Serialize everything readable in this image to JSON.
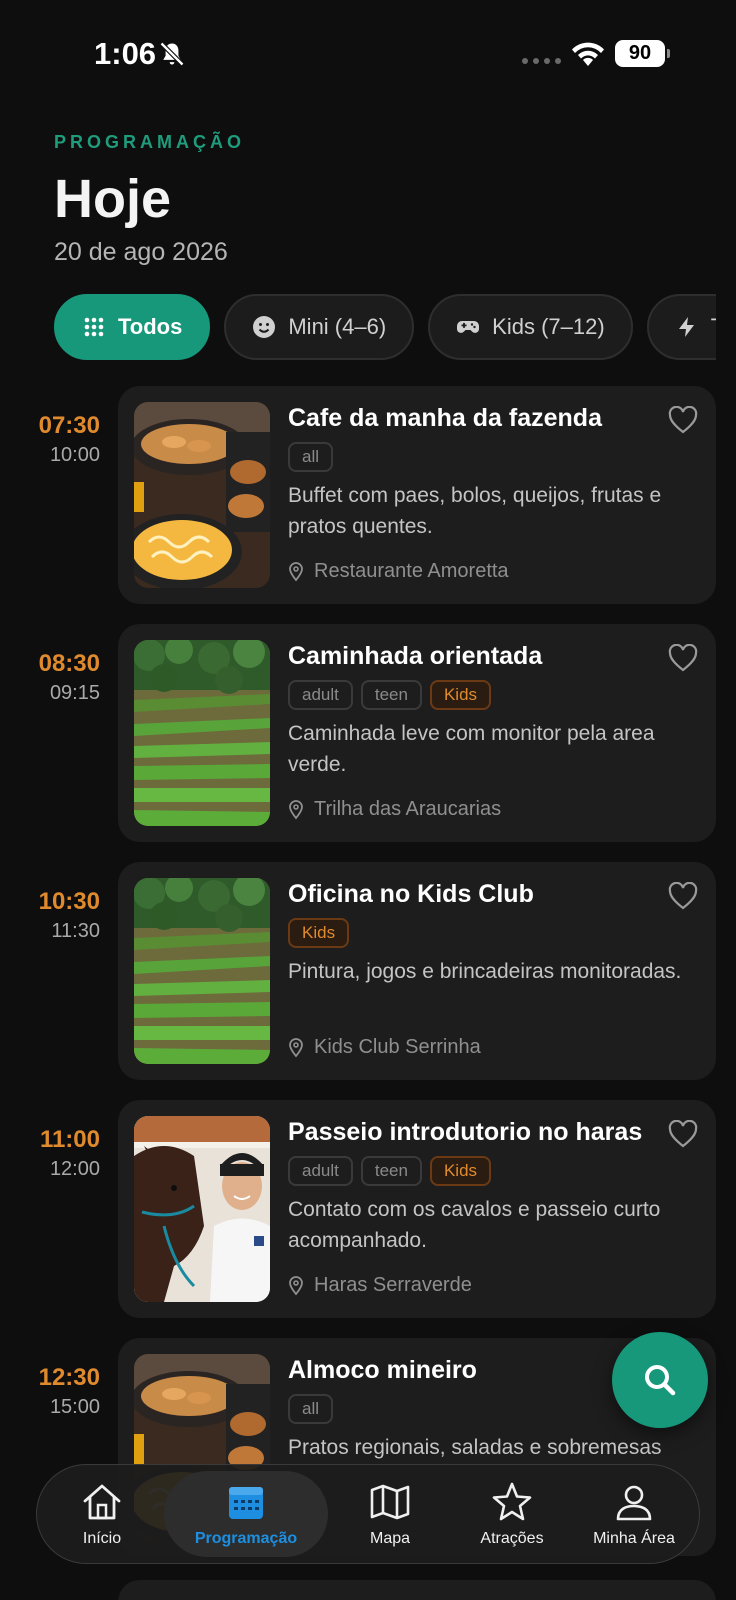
{
  "status_bar": {
    "time": "1:06",
    "battery": "90"
  },
  "header": {
    "kicker": "PROGRAMAÇÃO",
    "title": "Hoje",
    "date": "20 de ago 2026"
  },
  "filters": [
    {
      "label": "Todos",
      "icon": "grid-icon",
      "active": true
    },
    {
      "label": "Mini (4–6)",
      "icon": "smile-icon",
      "active": false
    },
    {
      "label": "Kids (7–12)",
      "icon": "gamepad-icon",
      "active": false
    },
    {
      "label": "T",
      "icon": "bolt-icon",
      "active": false
    }
  ],
  "events": [
    {
      "start": "07:30",
      "end": "10:00",
      "title": "Cafe da manha da fazenda",
      "tags": [
        "all"
      ],
      "description": "Buffet com paes, bolos, queijos, frutas e pratos quentes.",
      "location": "Restaurante Amoretta",
      "image": "food"
    },
    {
      "start": "08:30",
      "end": "09:15",
      "title": "Caminhada orientada",
      "tags": [
        "adult",
        "teen",
        "Kids"
      ],
      "description": "Caminhada leve com monitor pela area verde.",
      "location": "Trilha das Araucarias",
      "image": "garden"
    },
    {
      "start": "10:30",
      "end": "11:30",
      "title": "Oficina no Kids Club",
      "tags": [
        "Kids"
      ],
      "description": "Pintura, jogos e brincadeiras monitoradas.",
      "location": "Kids Club Serrinha",
      "image": "garden"
    },
    {
      "start": "11:00",
      "end": "12:00",
      "title": "Passeio introdutorio no haras",
      "tags": [
        "adult",
        "teen",
        "Kids"
      ],
      "description": "Contato com os cavalos e passeio curto acompanhado.",
      "location": "Haras Serraverde",
      "image": "horse"
    },
    {
      "start": "12:30",
      "end": "15:00",
      "title": "Almoco mineiro",
      "tags": [
        "all"
      ],
      "description": "Pratos regionais, saladas e sobremesas",
      "location": "",
      "image": "food"
    }
  ],
  "nav": [
    {
      "label": "Início",
      "icon": "home-icon",
      "active": false
    },
    {
      "label": "Programação",
      "icon": "calendar-icon",
      "active": true
    },
    {
      "label": "Mapa",
      "icon": "map-icon",
      "active": false
    },
    {
      "label": "Atrações",
      "icon": "star-icon",
      "active": false
    },
    {
      "label": "Minha Área",
      "icon": "user-icon",
      "active": false
    }
  ],
  "colors": {
    "accent": "#17987a",
    "time": "#e08a2e",
    "nav_active": "#1e8fe0",
    "background": "#0e0e0e",
    "card": "#1d1d1d"
  }
}
